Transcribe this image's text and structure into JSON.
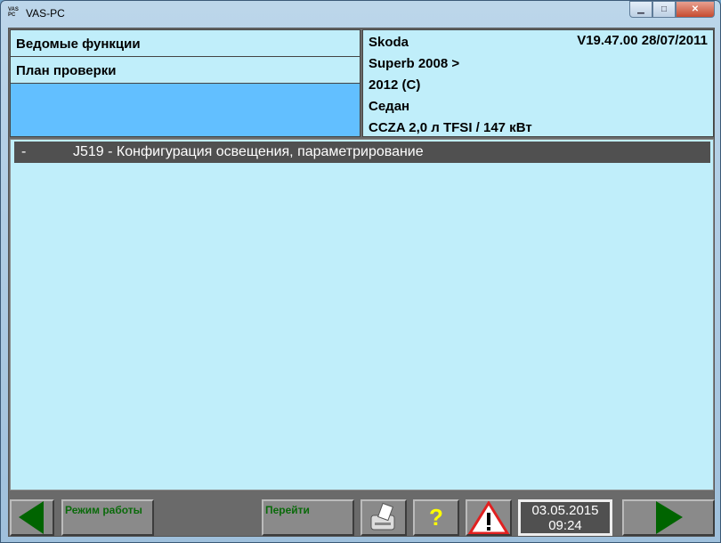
{
  "window": {
    "title": "VAS-PC",
    "icon_text": "VAS PC"
  },
  "left_panel": {
    "items": [
      {
        "label": "Ведомые функции"
      },
      {
        "label": "План проверки"
      }
    ]
  },
  "vehicle": {
    "make": "Skoda",
    "version": "V19.47.00 28/07/2011",
    "model": "Superb 2008 >",
    "year": "2012 (C)",
    "body": "Седан",
    "engine": "CCZA 2,0 л TFSI / 147 кВт"
  },
  "list": {
    "items": [
      {
        "prefix": "-",
        "label": "J519 - Конфигурация освещения, параметрирование",
        "selected": true
      }
    ]
  },
  "toolbar": {
    "mode_label": "Режим работы",
    "goto_label": "Перейти",
    "help_label": "?",
    "date": "03.05.2015",
    "time": "09:24",
    "accent": "#006400"
  }
}
